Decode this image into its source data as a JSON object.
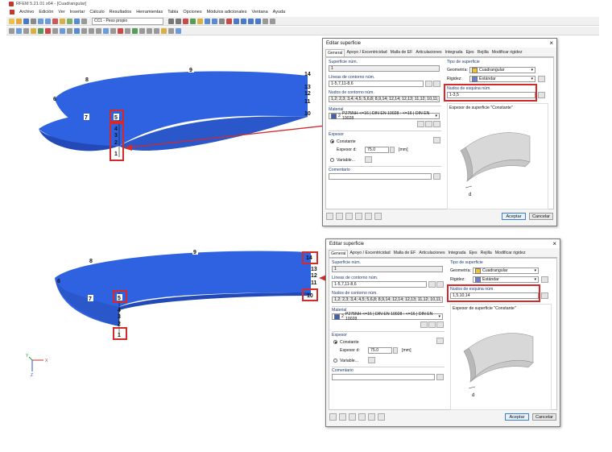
{
  "window": {
    "title": "RFEM 5.21.01 x64 - [Cuadrangular]"
  },
  "menu": [
    "Archivo",
    "Edición",
    "Ver",
    "Insertar",
    "Cálculo",
    "Resultados",
    "Herramientas",
    "Tabla",
    "Opciones",
    "Módulos adicionales",
    "Ventana",
    "Ayuda"
  ],
  "toolbar": {
    "load_case": "CC1 - Peso propio"
  },
  "axes": {
    "x": "X",
    "y": "Y",
    "z": "Z"
  },
  "top_model": {
    "labels": [
      "8",
      "9",
      "14",
      "13",
      "12",
      "11",
      "6",
      "10",
      "7",
      "5",
      "4",
      "3",
      "2",
      "1"
    ]
  },
  "bottom_model": {
    "labels": [
      "8",
      "9",
      "14",
      "13",
      "12",
      "11",
      "6",
      "10",
      "7",
      "5",
      "4",
      "3",
      "2",
      "1"
    ]
  },
  "dialogs": [
    {
      "title": "Editar superficie",
      "tabs": [
        "General",
        "Apoyo / Excentricidad",
        "Malla de EF",
        "Articulaciones",
        "Integrada",
        "Ejes",
        "Rejilla",
        "Modificar rigidez"
      ],
      "surface_no_label": "Superficie núm.",
      "surface_no": "1",
      "boundary_lines_label": "Líneas de contorno núm.",
      "boundary_lines": "1-5,7,11-8,6",
      "boundary_nodes_label": "Nudos de contorno núm.",
      "boundary_nodes": "1,2; 2,3; 3,4; 4,5; 5,6,8; 8,9,14; 12,14; 12,13; 11,12; 10,11; 1,7,1",
      "material_label": "Material",
      "material_no": "2",
      "material_desc": "P275NH <=16 | DIN EN 10028 : <=16 | DIN EN 10028",
      "thickness_label": "Espesor",
      "constant_label": "Constante",
      "thickness_d_label": "Espesor d:",
      "thickness_value": "75.0",
      "thickness_unit": "[mm]",
      "variable_label": "Variable...",
      "comment_label": "Comentario",
      "surface_type_label": "Tipo de superficie",
      "geometry_label": "Geometría:",
      "geometry_value": "Cuadrangular",
      "stiffness_label": "Rigidez:",
      "stiffness_value": "Estándar",
      "corner_nodes_label": "Nudos de esquina núm.",
      "corner_nodes": "1-3,5",
      "preview_label": "Espesor de superficie \"Constante\"",
      "preview_dim": "d",
      "ok_label": "Aceptar",
      "cancel_label": "Cancelar"
    },
    {
      "title": "Editar superficie",
      "tabs": [
        "General",
        "Apoyo / Excentricidad",
        "Malla de EF",
        "Articulaciones",
        "Integrada",
        "Ejes",
        "Rejilla",
        "Modificar rigidez"
      ],
      "surface_no_label": "Superficie núm.",
      "surface_no": "1",
      "boundary_lines_label": "Líneas de contorno núm.",
      "boundary_lines": "1-5,7,11-8,6",
      "boundary_nodes_label": "Nudos de contorno núm.",
      "boundary_nodes": "1,2; 2,3; 3,4; 4,5; 5,6,8; 8,9,14; 12,14; 12,13; 11,12; 10,11; 1,7,1",
      "material_label": "Material",
      "material_no": "2",
      "material_desc": "P275NH <=16 | DIN EN 10028 : <=16 | DIN EN 10028",
      "thickness_label": "Espesor",
      "constant_label": "Constante",
      "thickness_d_label": "Espesor d:",
      "thickness_value": "75.0",
      "thickness_unit": "[mm]",
      "variable_label": "Variable...",
      "comment_label": "Comentario",
      "surface_type_label": "Tipo de superficie",
      "geometry_label": "Geometría:",
      "geometry_value": "Cuadrangular",
      "stiffness_label": "Rigidez:",
      "stiffness_value": "Estándar",
      "corner_nodes_label": "Nudos de esquina núm.",
      "corner_nodes": "1,5,10,14",
      "preview_label": "Espesor de superficie \"Constante\"",
      "preview_dim": "d",
      "ok_label": "Aceptar",
      "cancel_label": "Cancelar"
    }
  ],
  "colors": {
    "surface": "#2f62e0",
    "surface_dark": "#2348b8",
    "highlight": "#d42a2a",
    "material": "#3f5fb5",
    "geometry_swatch": "#f2c230",
    "stiffness_swatch": "#6f7fd8"
  }
}
